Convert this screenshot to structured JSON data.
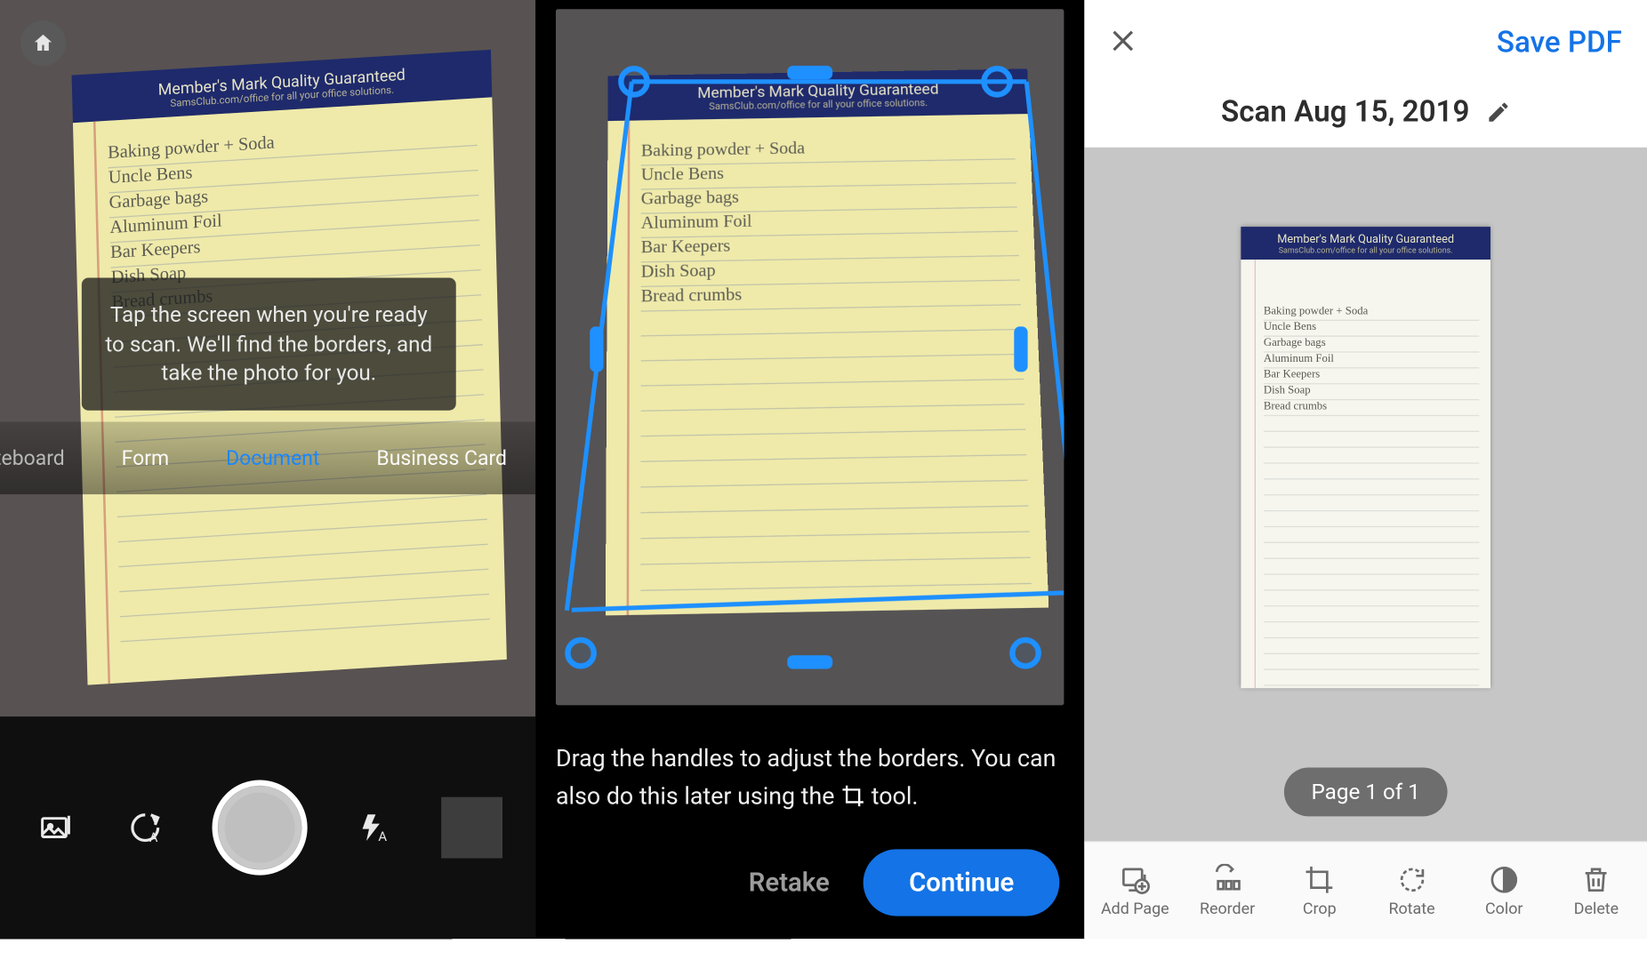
{
  "notepad": {
    "brand_title": "Member's Mark Quality Guaranteed",
    "brand_sub": "SamsClub.com/office for all your office solutions.",
    "lines": [
      "Baking powder + Soda",
      "Uncle Bens",
      "Garbage bags",
      "Aluminum Foil",
      "Bar Keepers",
      "Dish Soap",
      "Bread crumbs"
    ]
  },
  "panel1": {
    "tooltip": "Tap the screen when you're ready to scan. We'll find the borders, and take the photo for you.",
    "modes": {
      "m0": "Whiteboard",
      "m1": "Form",
      "m2": "Document",
      "m3": "Business Card"
    },
    "active_mode_index": 2
  },
  "panel2": {
    "instruction_pre": "Drag the handles to adjust the borders. You can also do this later using the ",
    "instruction_post": " tool.",
    "retake_label": "Retake",
    "continue_label": "Continue"
  },
  "panel3": {
    "save_label": "Save PDF",
    "doc_title": "Scan Aug 15, 2019",
    "page_indicator": "Page 1 of 1",
    "tools": {
      "add": "Add Page",
      "reorder": "Reorder",
      "crop": "Crop",
      "rotate": "Rotate",
      "color": "Color",
      "delete": "Delete"
    }
  }
}
